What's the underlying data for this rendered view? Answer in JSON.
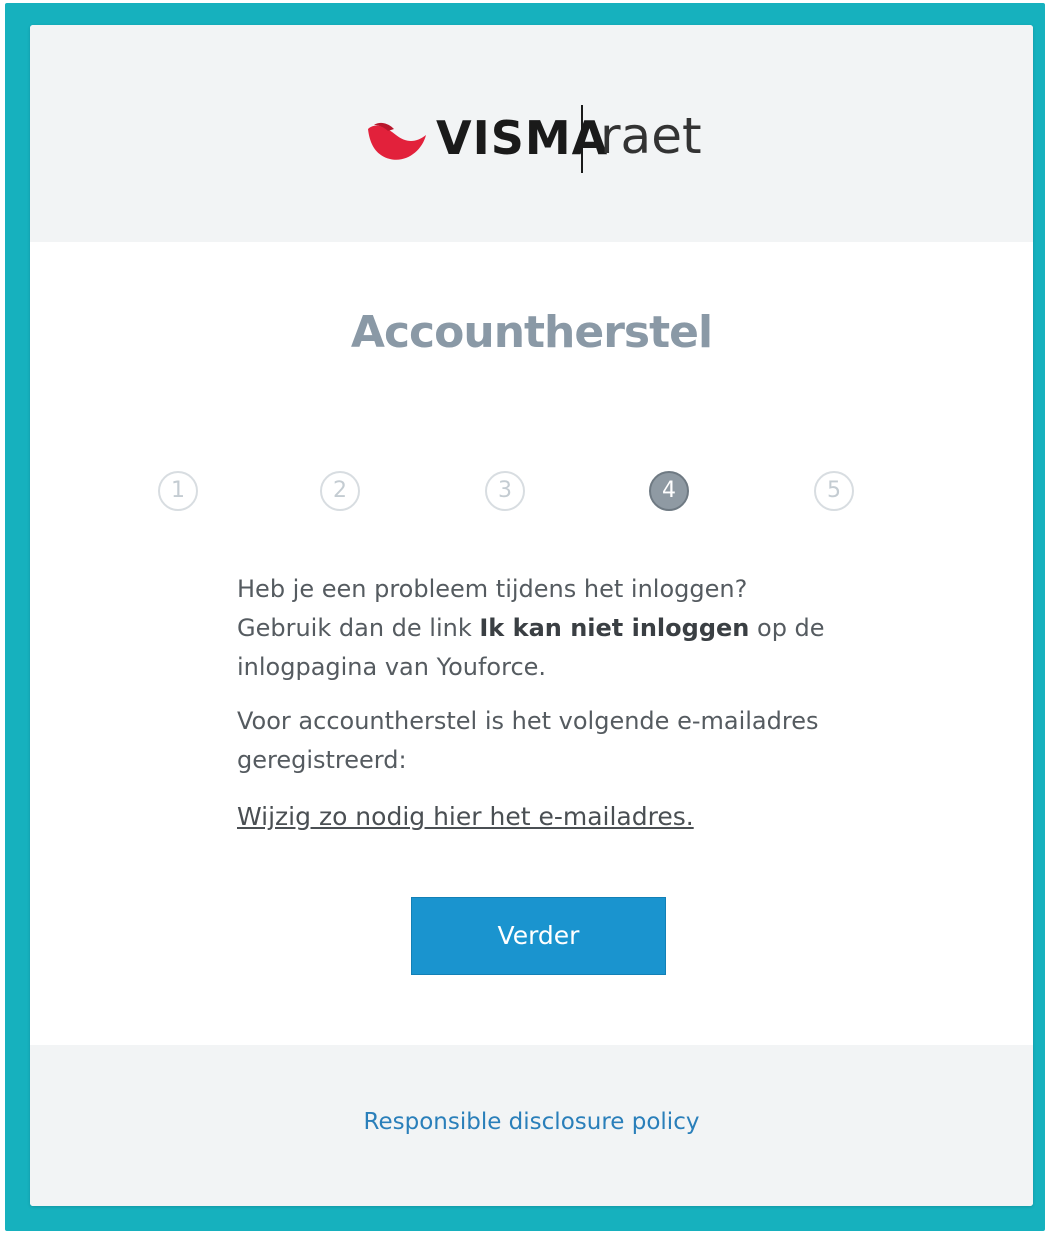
{
  "brand": {
    "name_primary": "VISMA",
    "name_secondary": "raet",
    "mark_color": "#e2213b",
    "frame_color": "#16b1be"
  },
  "page": {
    "title": "Accountherstel"
  },
  "steps": {
    "items": [
      "1",
      "2",
      "3",
      "4",
      "5"
    ],
    "active": "4"
  },
  "content": {
    "para1_part1": "Heb je een probleem tijdens het inloggen? Gebruik dan de link ",
    "para1_bold": "Ik kan niet inloggen",
    "para1_part2": " op de inlogpagina van Youforce.",
    "para2": "Voor accountherstel is het volgende e-mailadres geregistreerd:",
    "change_link": "Wijzig zo nodig hier het e-mailadres."
  },
  "actions": {
    "next_label": "Verder",
    "next_color": "#1a94cf"
  },
  "footer": {
    "link_label": "Responsible disclosure policy"
  }
}
